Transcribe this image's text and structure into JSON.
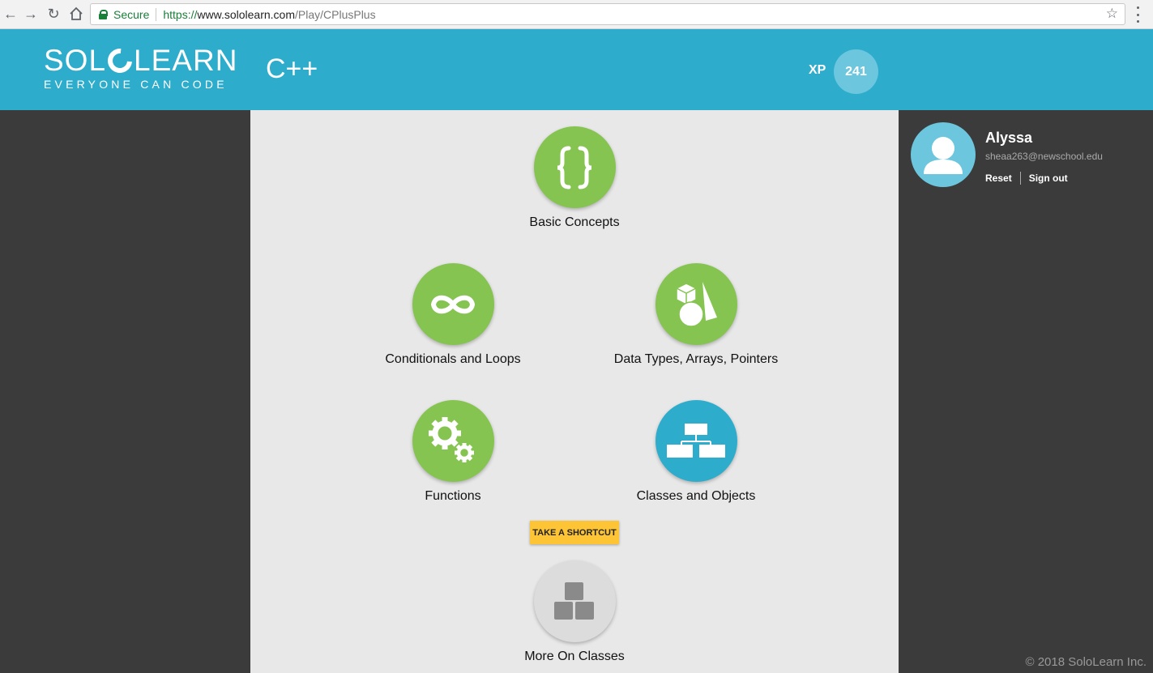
{
  "browser": {
    "secure_label": "Secure",
    "url_scheme": "https://",
    "url_host": "www.sololearn.com",
    "url_path": "/Play/CPlusPlus"
  },
  "header": {
    "logo_part1": "SOL",
    "logo_part2": "LEARN",
    "logo_tagline": "EVERYONE CAN CODE",
    "course_title": "C++",
    "xp_label": "XP",
    "xp_value": "241"
  },
  "modules": [
    {
      "label": "Basic Concepts",
      "icon": "curly-braces-icon",
      "state": "completed"
    },
    {
      "label": "Conditionals and Loops",
      "icon": "infinity-icon",
      "state": "completed"
    },
    {
      "label": "Data Types, Arrays, Pointers",
      "icon": "shapes-icon",
      "state": "completed"
    },
    {
      "label": "Functions",
      "icon": "gears-icon",
      "state": "completed"
    },
    {
      "label": "Classes and Objects",
      "icon": "hierarchy-icon",
      "state": "current"
    },
    {
      "label": "More On Classes",
      "icon": "blocks-icon",
      "state": "locked"
    }
  ],
  "shortcut_label": "TAKE A SHORTCUT",
  "user": {
    "name": "Alyssa",
    "email": "sheaa263@newschool.edu",
    "reset_label": "Reset",
    "signout_label": "Sign out"
  },
  "footer": "© 2018 SoloLearn Inc.",
  "colors": {
    "header": "#2eaccc",
    "completed": "#86c451",
    "current": "#2eaccc",
    "locked": "#dcdcdc",
    "shortcut": "#fdc535",
    "sidebar": "#3b3b3b",
    "panel": "#e8e8e8"
  }
}
